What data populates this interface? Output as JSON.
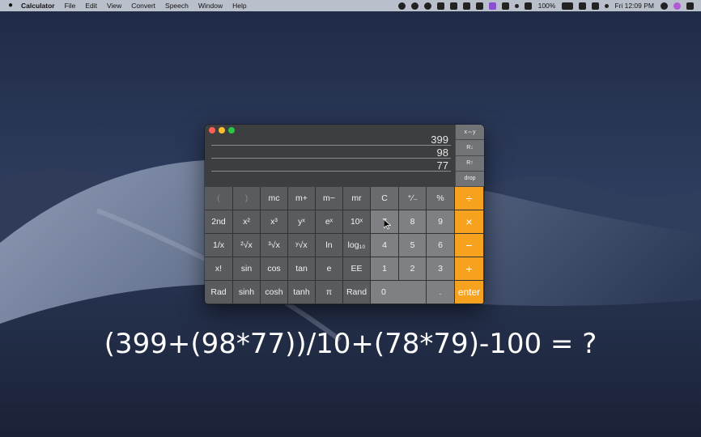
{
  "menubar": {
    "app_name": "Calculator",
    "menus": [
      "File",
      "Edit",
      "View",
      "Convert",
      "Speech",
      "Window",
      "Help"
    ],
    "battery": "100%",
    "clock": "Fri 12:09 PM"
  },
  "calculator": {
    "stack": [
      "399",
      "98",
      "77"
    ],
    "rpn_buttons": [
      "x⇔y",
      "R↓",
      "R↑",
      "drop"
    ],
    "rows": [
      [
        "(",
        ")",
        "mc",
        "m+",
        "m−",
        "mr",
        "C",
        "⁺∕₋",
        "%",
        "÷"
      ],
      [
        "2nd",
        "x²",
        "x³",
        "yˣ",
        "eˣ",
        "10ˣ",
        "7",
        "8",
        "9",
        "×"
      ],
      [
        "1/x",
        "²√x",
        "³√x",
        "ʸ√x",
        "ln",
        "log₁₀",
        "4",
        "5",
        "6",
        "−"
      ],
      [
        "x!",
        "sin",
        "cos",
        "tan",
        "e",
        "EE",
        "1",
        "2",
        "3",
        "+"
      ],
      [
        "Rad",
        "sinh",
        "cosh",
        "tanh",
        "π",
        "Rand",
        "0",
        ".",
        "enter"
      ]
    ]
  },
  "overlay": {
    "equation": "(399+(98*77))/10+(78*79)-100 = ?"
  },
  "colors": {
    "operator": "#f7a21f",
    "number_key": "#7e8083",
    "function_key": "#5a5b5e",
    "traffic_red": "#fe5f57",
    "traffic_yellow": "#febc2e",
    "traffic_green": "#28c840"
  }
}
